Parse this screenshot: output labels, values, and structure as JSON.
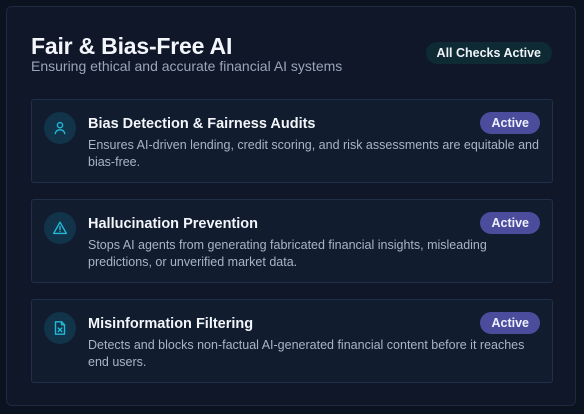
{
  "header": {
    "title": "Fair & Bias-Free AI",
    "subtitle": "Ensuring ethical and accurate financial AI systems",
    "status_label": "All Checks Active"
  },
  "items": [
    {
      "icon": "user-icon",
      "title": "Bias Detection & Fairness Audits",
      "description": "Ensures AI-driven lending, credit scoring, and risk assessments are equitable and bias-free.",
      "badge": "Active"
    },
    {
      "icon": "warning-triangle-icon",
      "title": "Hallucination Prevention",
      "description": "Stops AI agents from generating fabricated financial insights, misleading predictions, or unverified market data.",
      "badge": "Active"
    },
    {
      "icon": "file-x-icon",
      "title": "Misinformation Filtering",
      "description": "Detects and blocks non-factual AI-generated financial content before it reaches end users.",
      "badge": "Active"
    }
  ],
  "colors": {
    "background": "#0b1220",
    "card": "#0f1729",
    "icon_accent": "#22b8d6",
    "badge": "#4b4d9c"
  }
}
